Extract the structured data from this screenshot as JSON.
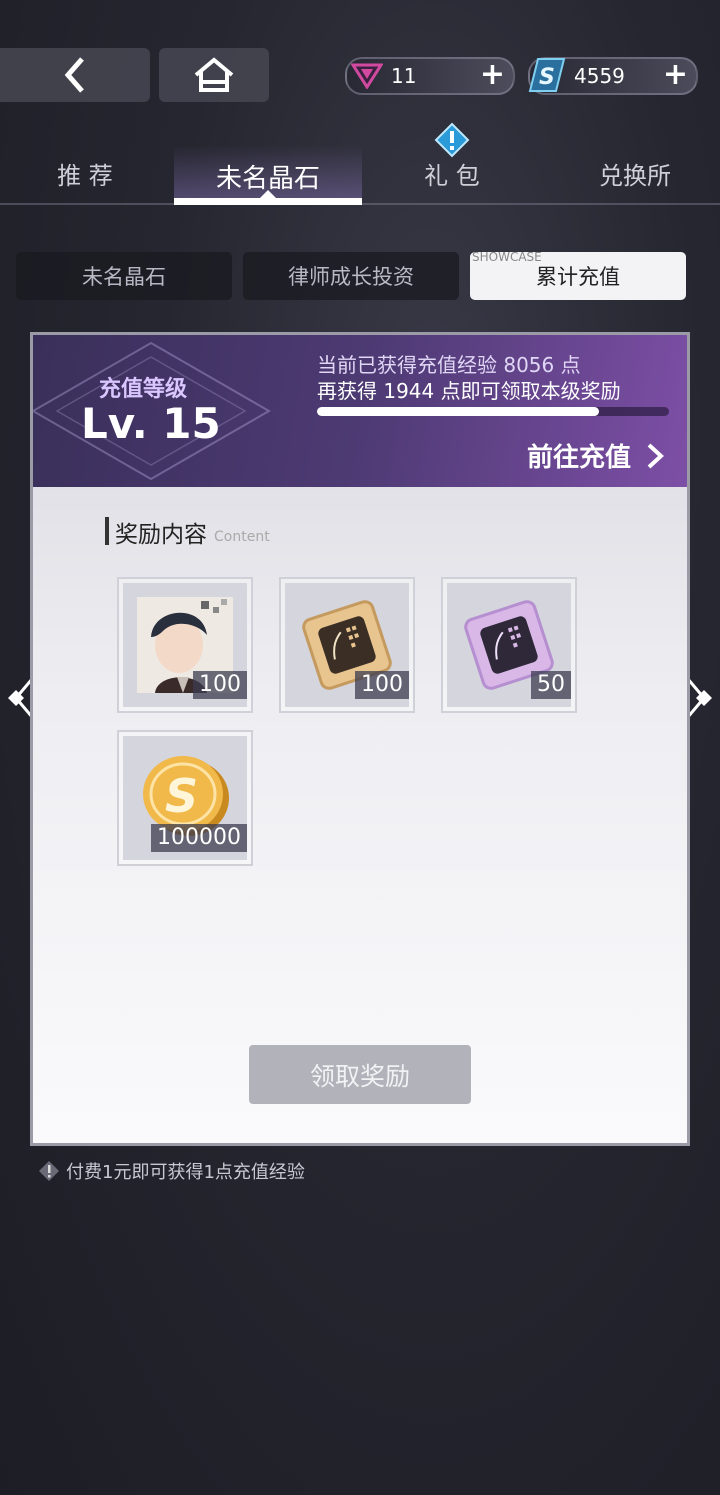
{
  "currency": {
    "gem_count": "11",
    "coin_count": "4559"
  },
  "tabs": {
    "recommend": "推 荐",
    "unnamed_crystal": "未名晶石",
    "gift_pack": "礼 包",
    "exchange": "兑换所"
  },
  "subtabs": {
    "crystal": "未名晶石",
    "investment": "律师成长投资",
    "cumulative": "累计充值",
    "showcase_label": "SHOWCASE"
  },
  "recharge": {
    "level_label": "充值等级",
    "level_value": "Lv. 15",
    "exp_line": "当前已获得充值经验 8056 点",
    "remain_line": "再获得 1944 点即可领取本级奖励",
    "progress": 0.8,
    "goto_label": "前往充值"
  },
  "rewards": {
    "title": "奖励内容",
    "title_en": "Content",
    "items": [
      {
        "qty": "100",
        "icon": "character-portrait-icon"
      },
      {
        "qty": "100",
        "icon": "gold-chip-icon"
      },
      {
        "qty": "50",
        "icon": "purple-chip-icon"
      },
      {
        "qty": "100000",
        "icon": "gold-coin-icon"
      }
    ],
    "claim_label": "领取奖励"
  },
  "note": "付费1元即可获得1点充值经验",
  "colors": {
    "accent_purple": "#7d4fa6",
    "alert_blue": "#2a9ad8",
    "gem_pink": "#d24aa0"
  }
}
